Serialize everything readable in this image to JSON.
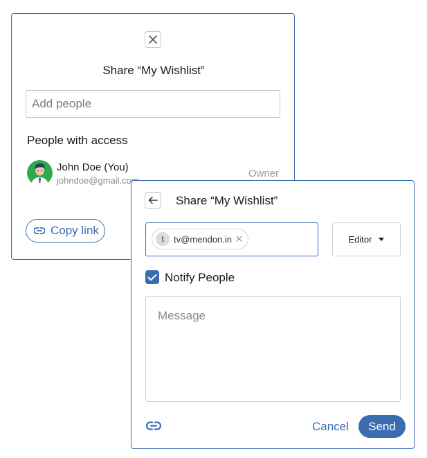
{
  "share_dialog": {
    "title": "Share “My Wishlist”",
    "add_people_placeholder": "Add people",
    "access_heading": "People with access",
    "person": {
      "name": "John Doe (You)",
      "email": "johndoe@gmail.com",
      "role": "Owner"
    },
    "copy_link_label": "Copy link"
  },
  "invite_dialog": {
    "title": "Share “My Wishlist”",
    "recipient_chip": {
      "initial": "t",
      "email": "tv@mendon.in"
    },
    "role_value": "Editor",
    "notify_label": "Notify People",
    "notify_checked": true,
    "message_placeholder": "Message",
    "cancel_label": "Cancel",
    "send_label": "Send"
  },
  "colors": {
    "accent": "#3a6cb0",
    "avatar_bg": "#2fa84f"
  }
}
